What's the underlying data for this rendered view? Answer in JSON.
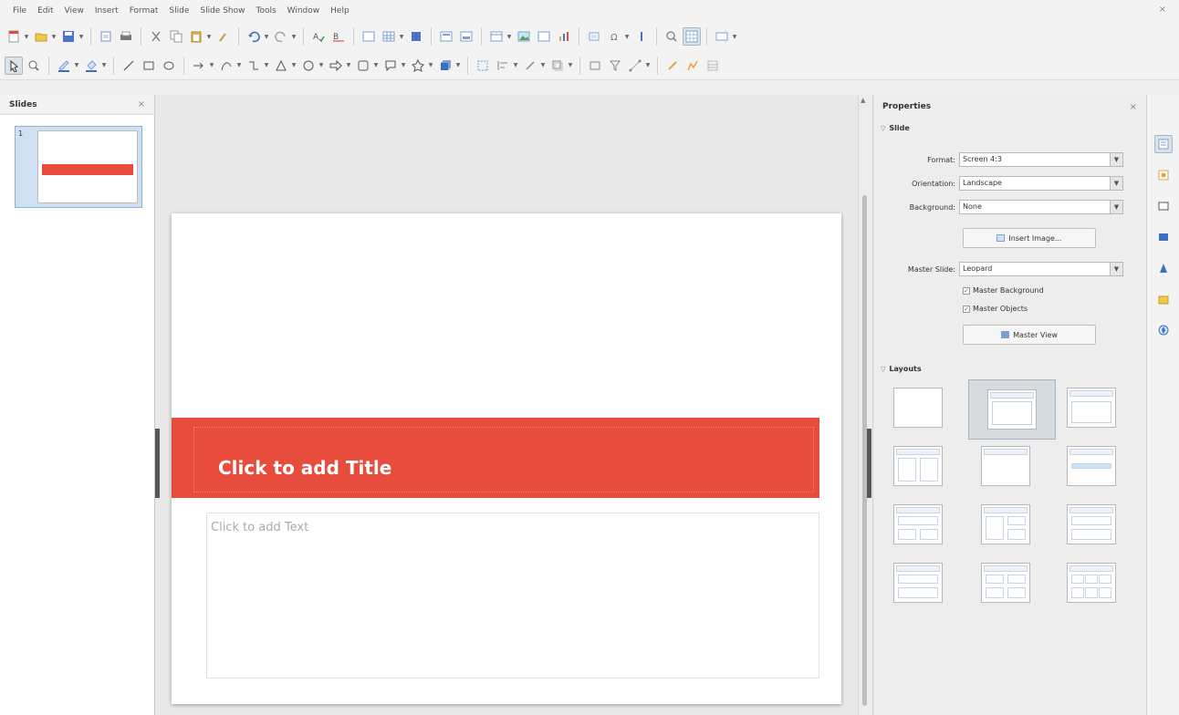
{
  "menubar": {
    "items": [
      "File",
      "Edit",
      "View",
      "Insert",
      "Format",
      "Slide",
      "Slide Show",
      "Tools",
      "Window",
      "Help"
    ],
    "close_label": "×"
  },
  "slides_pane": {
    "title": "Slides",
    "close_label": "×",
    "slide_number": "1"
  },
  "slide": {
    "title_placeholder": "Click to add Title",
    "content_placeholder": "Click to add Text"
  },
  "properties": {
    "title": "Properties",
    "close_label": "×",
    "slide_section": {
      "title": "Slide",
      "format_label": "Format:",
      "format_value": "Screen 4:3",
      "orientation_label": "Orientation:",
      "orientation_value": "Landscape",
      "background_label": "Background:",
      "background_value": "None",
      "insert_image_label": "Insert Image...",
      "master_slide_label": "Master Slide:",
      "master_slide_value": "Leopard",
      "master_background_label": "Master Background",
      "master_objects_label": "Master Objects",
      "master_view_label": "Master View"
    },
    "layouts_section": {
      "title": "Layouts"
    }
  },
  "colors": {
    "accent_red": "#e84c3d",
    "selection_blue": "#cfe0f2"
  },
  "icons": {
    "toolbar1": [
      "new-icon",
      "open-icon",
      "save-icon",
      "pdf-icon",
      "print-icon",
      "cut-icon",
      "copy-icon",
      "paste-icon",
      "clone-formatting-icon",
      "undo-icon",
      "redo-icon",
      "spellcheck-icon",
      "autospell-icon",
      "display-grid-icon",
      "table-icon",
      "chart-icon",
      "slide-icon",
      "duplicate-slide-icon",
      "layout-icon",
      "image-icon",
      "textbox-icon",
      "chart2-icon",
      "fontwork-icon",
      "special-char-icon",
      "hyperlink-icon",
      "master-icon",
      "slide-view-icon",
      "more-icon"
    ],
    "toolbar2": [
      "select-icon",
      "zoom-icon",
      "line-color-icon",
      "fill-color-icon",
      "line-icon",
      "rectangle-icon",
      "ellipse-icon",
      "arrow-icon",
      "curve-icon",
      "connector-icon",
      "basic-shapes-icon",
      "symbol-shapes-icon",
      "block-arrows-icon",
      "flowchart-icon",
      "callouts-icon",
      "stars-icon",
      "3d-objects-icon",
      "rotate-icon",
      "align-icon",
      "arrange-icon",
      "shadow-icon",
      "crop-icon",
      "filter-icon",
      "points-icon",
      "glue-icon",
      "extrusion-icon"
    ],
    "tabbar": [
      "properties-tab-icon",
      "slide-transition-icon",
      "custom-animation-icon",
      "master-slides-icon",
      "styles-icon",
      "gallery-icon",
      "navigator-icon"
    ]
  }
}
